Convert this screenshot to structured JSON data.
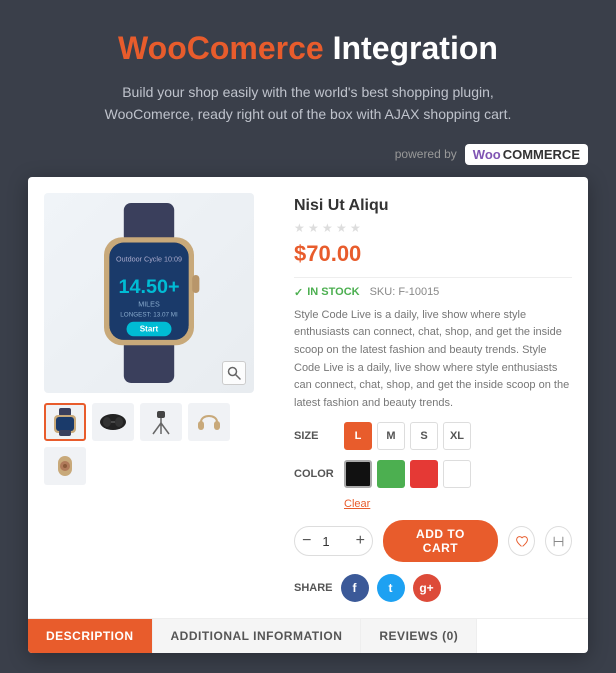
{
  "header": {
    "title_woo": "WooComerce",
    "title_rest": "Integration",
    "subtitle": "Build your shop easily with the world's best shopping plugin, WooComerce, ready right out of the box with AJAX shopping cart.",
    "powered_by": "powered by",
    "badge_woo": "Woo",
    "badge_commerce": "COMMERCE"
  },
  "product": {
    "name": "Nisi Ut Aliqu",
    "price": "$70.00",
    "stock_status": "IN STOCK",
    "sku_label": "SKU:",
    "sku_value": "F-10015",
    "description": "Style Code Live is a daily, live show where style enthusiasts can connect, chat, shop, and get the inside scoop on the latest fashion and beauty trends. Style Code Live is a daily, live show where style enthusiasts can connect, chat, shop, and get the inside scoop on the latest fashion and beauty trends.",
    "size_label": "SIZE",
    "sizes": [
      "L",
      "M",
      "S",
      "XL"
    ],
    "color_label": "COLOR",
    "colors": [
      "#111111",
      "#4caf50",
      "#e53935",
      "#ffffff"
    ],
    "clear_label": "Clear",
    "qty": "1",
    "add_to_cart_label": "Add To Cart",
    "share_label": "SHARE",
    "tabs": [
      "DESCRIPTION",
      "ADDITIONAL INFORMATION",
      "REVIEWS (0)"
    ]
  }
}
